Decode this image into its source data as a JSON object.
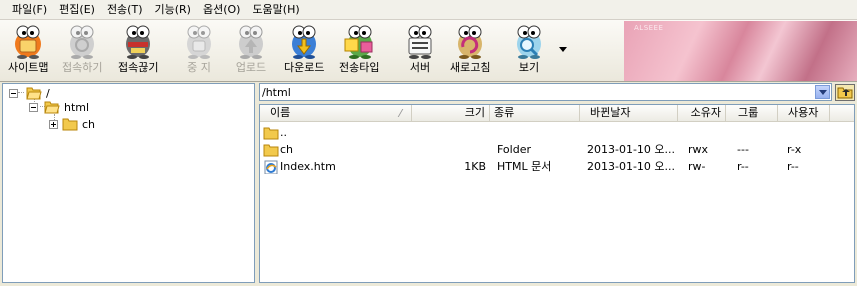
{
  "menu": [
    {
      "label": "파일(F)"
    },
    {
      "label": "편집(E)"
    },
    {
      "label": "전송(T)"
    },
    {
      "label": "기능(R)"
    },
    {
      "label": "옵션(O)"
    },
    {
      "label": "도움말(H)"
    }
  ],
  "toolbar": {
    "buttons": [
      {
        "label": "사이트맵",
        "icon": "sitemap-icon",
        "enabled": true
      },
      {
        "label": "접속하기",
        "icon": "connect-icon",
        "enabled": false
      },
      {
        "label": "접속끊기",
        "icon": "disconnect-icon",
        "enabled": true
      },
      {
        "label": "중 지",
        "icon": "stop-icon",
        "enabled": false
      },
      {
        "label": "업로드",
        "icon": "upload-icon",
        "enabled": false
      },
      {
        "label": "다운로드",
        "icon": "download-icon",
        "enabled": true
      },
      {
        "label": "전송타입",
        "icon": "transfer-type-icon",
        "enabled": true
      },
      {
        "label": "서버",
        "icon": "server-icon",
        "enabled": true
      },
      {
        "label": "새로고침",
        "icon": "refresh-icon",
        "enabled": true
      },
      {
        "label": "보기",
        "icon": "view-icon",
        "enabled": true
      }
    ],
    "more_icon": "dropdown-arrow-icon"
  },
  "banner": {
    "text": "ALSEEE"
  },
  "tree": {
    "nodes": [
      {
        "label": "/",
        "expanded": true
      },
      {
        "label": "html",
        "expanded": true
      },
      {
        "label": "ch",
        "expanded": false
      }
    ]
  },
  "path": {
    "value": "/html"
  },
  "file_list": {
    "columns": [
      "이름",
      "크기",
      "종류",
      "바뀐날자",
      "소유자",
      "그룹",
      "사용자"
    ],
    "rows": [
      {
        "name": "..",
        "size": "",
        "type": "",
        "modified": "",
        "owner": "",
        "group": "",
        "user": "",
        "icon": "folder-icon"
      },
      {
        "name": "ch",
        "size": "",
        "type": "Folder",
        "modified": "2013-01-10 오...",
        "owner": "rwx",
        "group": "---",
        "user": "r-x",
        "icon": "folder-icon"
      },
      {
        "name": "Index.htm",
        "size": "1KB",
        "type": "HTML 문서",
        "modified": "2013-01-10 오...",
        "owner": "rw-",
        "group": "r--",
        "user": "r--",
        "icon": "html-file-icon"
      }
    ]
  },
  "colors": {
    "chrome_bg": "#ece9d8",
    "pane_border": "#7f9db9",
    "folder_yellow": "#f2c94c",
    "banner_pink": "#e9a3b6"
  }
}
